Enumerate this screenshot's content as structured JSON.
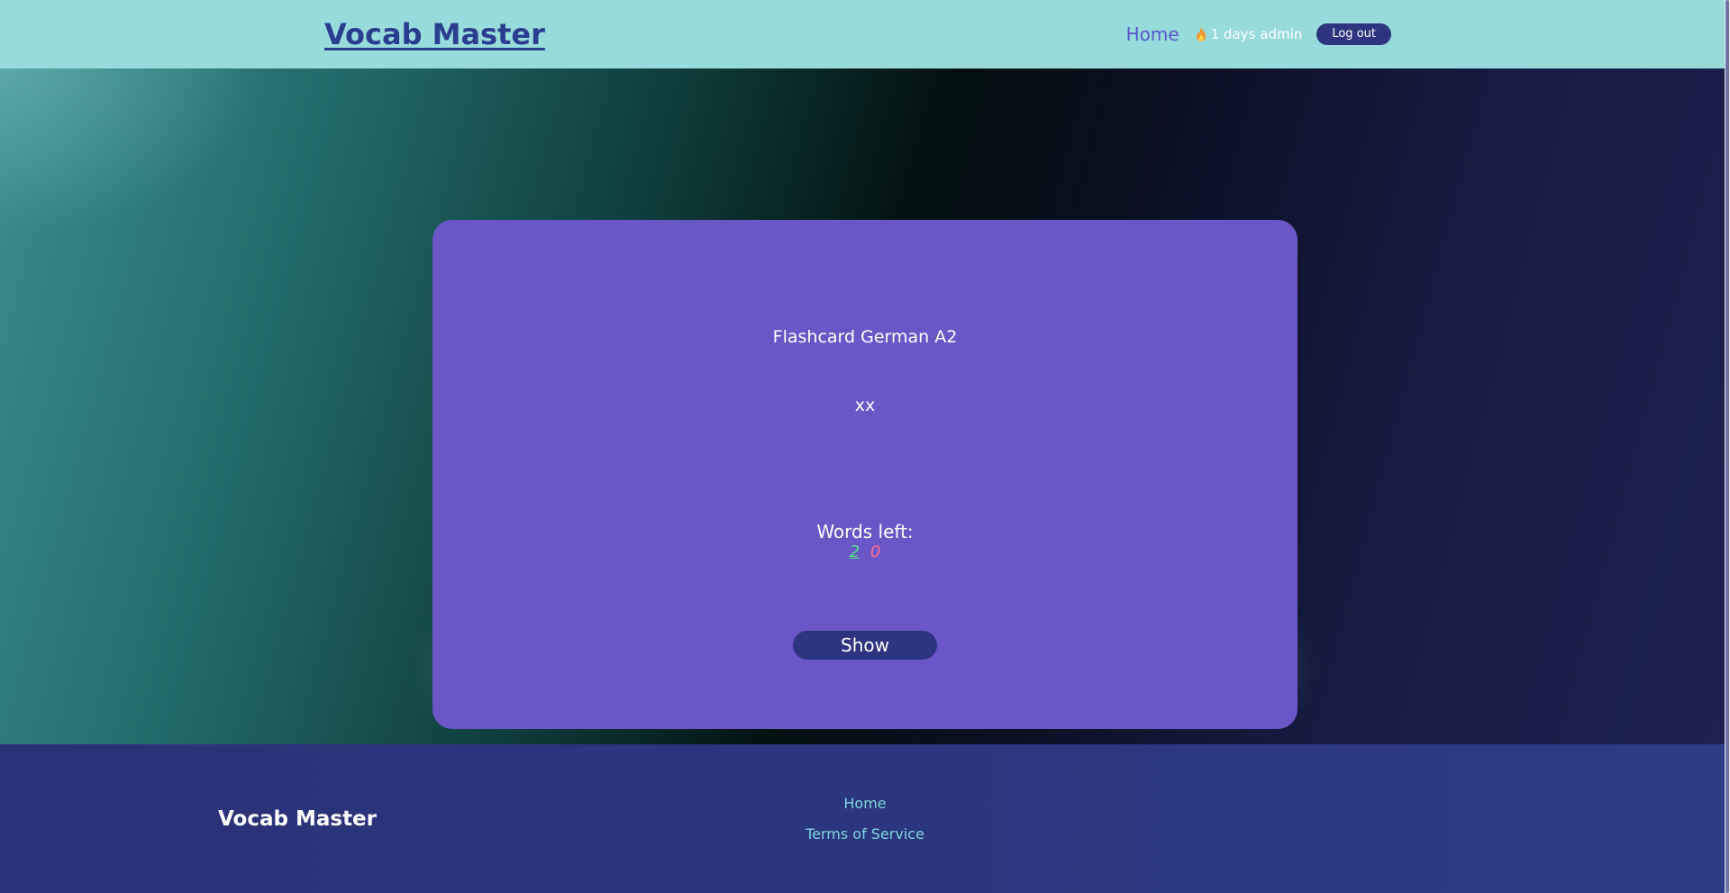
{
  "header": {
    "logo": "Vocab Master",
    "nav_home": "Home",
    "streak_days": "1 days",
    "streak_user": "admin",
    "logout_label": "Log out"
  },
  "card": {
    "title": "Flashcard German A2",
    "word": "xx",
    "words_left_label": "Words left:",
    "known_count": "2",
    "unknown_count": "0",
    "show_label": "Show"
  },
  "footer": {
    "brand": "Vocab Master",
    "links": [
      "Home",
      "Terms of Service"
    ]
  },
  "icons": {
    "streak": "fire-icon"
  },
  "colors": {
    "header_bg": "#97dcdb",
    "logo": "#2b3d8f",
    "card_bg": "#6a56c7",
    "button_bg": "#2d3480",
    "known_count": "#57e08a",
    "unknown_count": "#ff6f93",
    "footer_bg": "#293276",
    "footer_link": "#7fd4dc"
  }
}
